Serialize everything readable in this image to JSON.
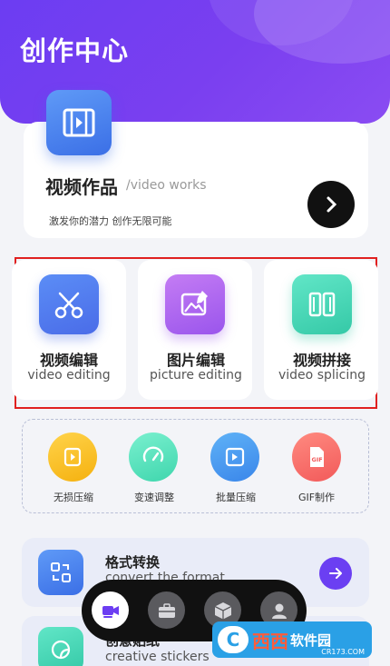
{
  "header": {
    "title": "创作中心"
  },
  "works": {
    "title": "视频作品",
    "subtitle": "/video works",
    "description": "激发你的潜力 创作无限可能",
    "icon": "film-icon"
  },
  "editors": [
    {
      "label": "视频编辑",
      "sub": "video editing",
      "icon": "scissors-icon"
    },
    {
      "label": "图片编辑",
      "sub": "picture editing",
      "icon": "image-edit-icon"
    },
    {
      "label": "视频拼接",
      "sub": "video splicing",
      "icon": "splice-icon"
    }
  ],
  "tools": [
    {
      "label": "无损压缩",
      "icon": "compress-icon"
    },
    {
      "label": "变速调整",
      "icon": "speed-icon"
    },
    {
      "label": "批量压缩",
      "icon": "batch-compress-icon"
    },
    {
      "label": "GIF制作",
      "icon": "gif-icon"
    }
  ],
  "rows": [
    {
      "title": "格式转换",
      "sub": "convert the format",
      "icon": "convert-icon"
    },
    {
      "title": "创意贴纸",
      "sub": "creative stickers",
      "icon": "sticker-icon"
    }
  ],
  "tabbar": {
    "icons": [
      "video-camera-icon",
      "toolbox-icon",
      "box-icon",
      "profile-icon"
    ]
  },
  "watermark": {
    "logo": "C",
    "brand": "西西",
    "text": "软件园",
    "url": "CR173.COM"
  },
  "colors": {
    "accent": "#6c3df2",
    "highlight_border": "#e02020"
  }
}
